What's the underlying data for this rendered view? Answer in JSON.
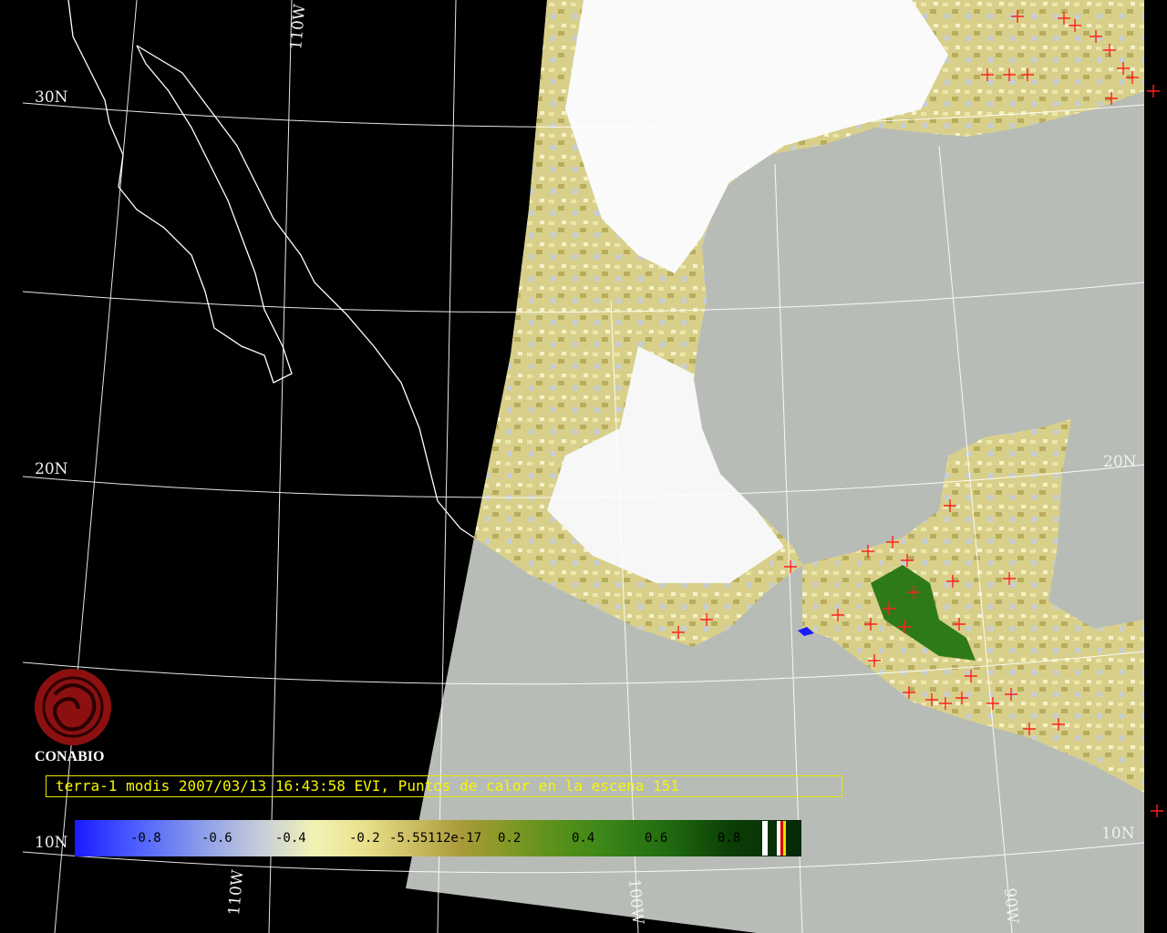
{
  "grid_labels": {
    "lat_30": "30N",
    "lat_20_left": "20N",
    "lat_20_right": "20N",
    "lat_10_left": "10N",
    "lat_10_right": "10N",
    "lon_110_top": "110W",
    "lon_110_bottom": "110W",
    "lon_100_bottom": "100W",
    "lon_90_bottom": "90W"
  },
  "logo": {
    "name": "CONABIO"
  },
  "caption": "terra-1 modis 2007/03/13 16:43:58 EVI, Puntos de calor en la escena 151",
  "colorbar": {
    "labels": [
      "-0.8",
      "-0.6",
      "-0.4",
      "-0.2",
      "-5.55112e-17",
      "0.2",
      "0.4",
      "0.6",
      "0.8"
    ],
    "colors": {
      "low": "#1a1aff",
      "mid": "#f3f3b4",
      "high": "#062806"
    }
  },
  "colors": {
    "ocean": "#b8bcb6",
    "cloud": "#ffffff",
    "fire": "#ff2020",
    "coast": "#ffffff"
  }
}
